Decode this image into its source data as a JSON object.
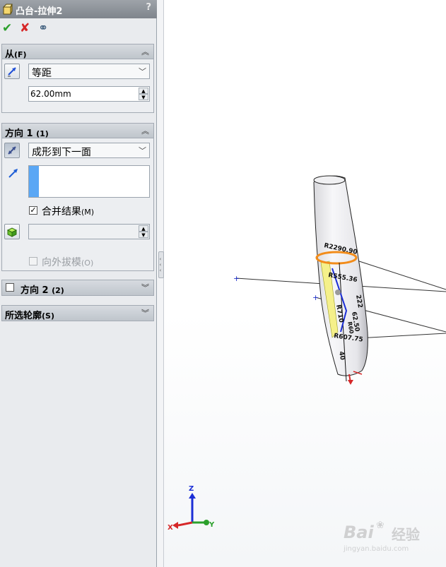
{
  "window": {
    "title": "凸台-拉伸2",
    "help": "?"
  },
  "actions": {
    "ok_glyph": "✔",
    "cancel_glyph": "✘",
    "preview_glyph": "⚭"
  },
  "from_group": {
    "title": "从",
    "key": "(F)",
    "type_value": "等距",
    "offset_value": "62.00mm"
  },
  "direction1_group": {
    "title": "方向 1",
    "key": "(1)",
    "end_condition_value": "成形到下一面",
    "direction_list_value": "",
    "merge_label": "合并结果",
    "merge_key": "(M)",
    "merge_checked": "✓",
    "draft_label": "向外拔模",
    "draft_key": "(O)",
    "draft_angle_value": ""
  },
  "direction2_group": {
    "title": "方向 2",
    "key": "(2)"
  },
  "contours_group": {
    "title": "所选轮廓",
    "key": "(S)"
  },
  "model_annotations": [
    "R2290.90",
    "R555.36",
    "R710",
    "R60",
    "222",
    "62.50",
    "R607.75",
    "40"
  ],
  "triad": {
    "x": "X",
    "y": "Y",
    "z": "Z"
  },
  "watermark": {
    "brand": "Bai",
    "brand_sub": "经验",
    "url": "jingyan.baidu.com"
  },
  "colors": {
    "accent_blue": "#5aa7f5",
    "ok_green": "#2ca02c",
    "cancel_red": "#d62728",
    "highlight_orange": "#f28c1a"
  }
}
